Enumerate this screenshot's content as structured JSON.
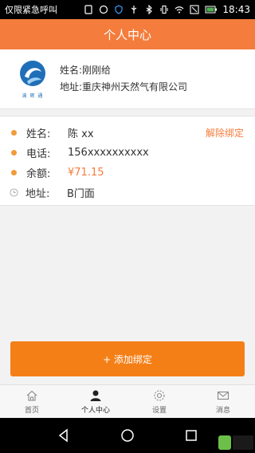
{
  "status_bar": {
    "carrier": "仅限紧急呼叫",
    "time": "18:43"
  },
  "header": {
    "title": "个人中心"
  },
  "company": {
    "logo_text": "渝 辉 通",
    "name": "姓名:刚刚给",
    "address": "地址:重庆神州天然气有限公司"
  },
  "details": {
    "name_label": "姓名:",
    "name_value": "陈 xx",
    "phone_label": "电话:",
    "phone_value": "156xxxxxxxxxx",
    "balance_label": "余额:",
    "balance_value": "¥71.15",
    "address_label": "地址:",
    "address_value": "B门面",
    "unbind_label": "解除绑定"
  },
  "add_button": {
    "label": "+ 添加绑定"
  },
  "tabs": [
    {
      "label": "首页",
      "icon": "home-icon"
    },
    {
      "label": "个人中心",
      "icon": "user-icon"
    },
    {
      "label": "设置",
      "icon": "gear-icon"
    },
    {
      "label": "消息",
      "icon": "mail-icon"
    }
  ],
  "colors": {
    "accent": "#f47c3c",
    "button": "#f57f17",
    "dot": "#f39a3a"
  }
}
